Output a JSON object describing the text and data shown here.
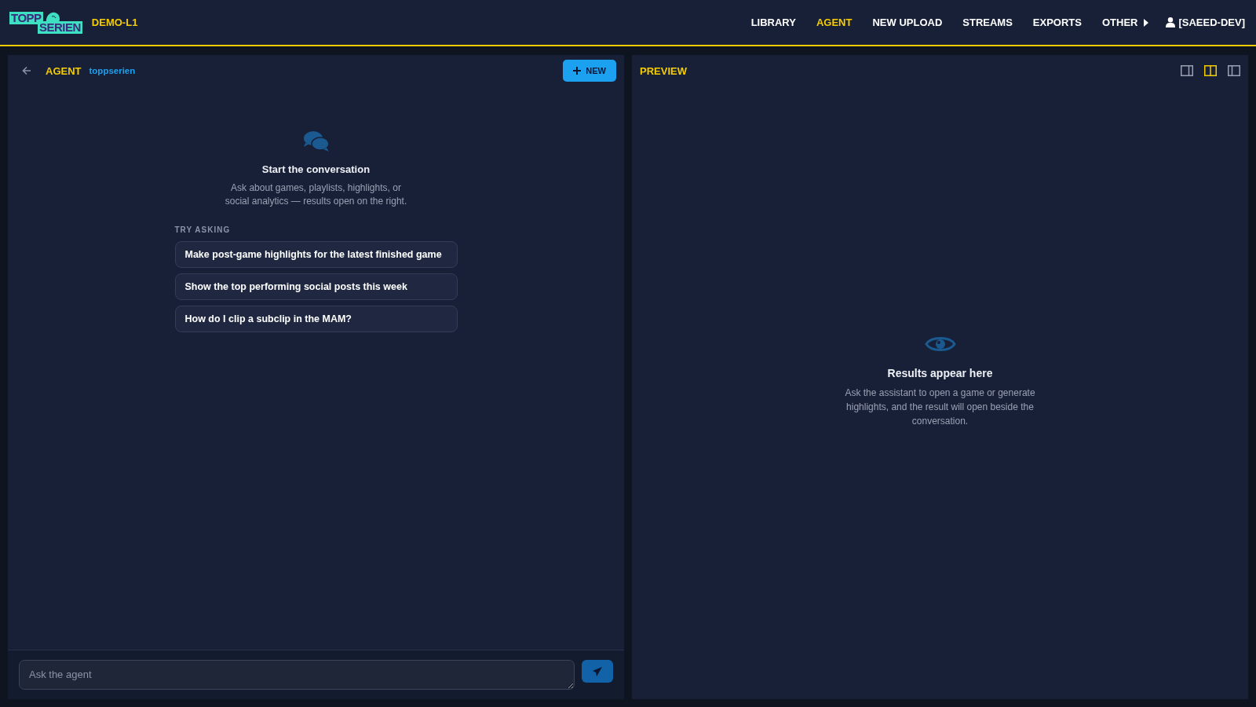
{
  "header": {
    "logo": {
      "line_1": "TOPP",
      "line_2": "SERIEN"
    },
    "env": "DEMO-L1",
    "nav": [
      {
        "label": "LIBRARY",
        "selected": false
      },
      {
        "label": "AGENT",
        "selected": true
      },
      {
        "label": "NEW UPLOAD",
        "selected": false
      },
      {
        "label": "STREAMS",
        "selected": false
      },
      {
        "label": "EXPORTS",
        "selected": false
      },
      {
        "label": "OTHER",
        "selected": false,
        "kind": "menu"
      }
    ],
    "user": "[SAEED-DEV]"
  },
  "agent_panel": {
    "title": "AGENT",
    "subtitle": "toppserien",
    "new_button": "NEW",
    "empty_title": "Start the conversation",
    "empty_text": "Ask about games, playlists, highlights, or social analytics — results open on the right.",
    "suggestions_label": "TRY ASKING",
    "suggestions": [
      "Make post-game highlights for the latest finished game",
      "Show the top performing social posts this week",
      "How do I clip a subclip in the MAM?"
    ],
    "input": {
      "placeholder": "Ask the agent"
    }
  },
  "preview_panel": {
    "title": "PREVIEW",
    "layout_buttons": [
      {
        "kind": "right",
        "selected": false
      },
      {
        "kind": "split",
        "selected": true
      },
      {
        "kind": "left",
        "selected": false
      }
    ],
    "empty_title": "Results appear here",
    "empty_text": "Ask the assistant to open a game or generate highlights, and the result will open beside the conversation."
  }
}
